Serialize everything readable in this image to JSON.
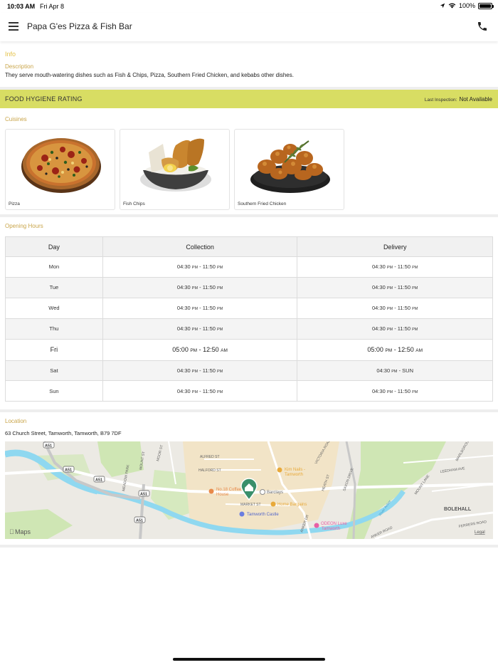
{
  "status_bar": {
    "time": "10:03 AM",
    "date": "Fri Apr 8",
    "battery": "100%"
  },
  "header": {
    "title": "Papa G'es Pizza & Fish Bar",
    "menu_icon": "hamburger-menu-icon",
    "phone_icon": "phone-icon"
  },
  "info": {
    "title": "Info",
    "description_label": "Description",
    "description": "They serve mouth-watering dishes such as Fish & Chips, Pizza, Southern Fried Chicken,  and kebabs other dishes."
  },
  "hygiene": {
    "title": "FOOD HYGIENE RATING",
    "last_inspection_label": "Last Inspection:",
    "last_inspection_value": "Not Available",
    "color": "#d8dd63"
  },
  "cuisines": {
    "label": "Cuisines",
    "items": [
      {
        "name": "Pizza"
      },
      {
        "name": "Fish  Chips"
      },
      {
        "name": "Southern Fried Chicken"
      }
    ]
  },
  "opening_hours": {
    "label": "Opening Hours",
    "headers": [
      "Day",
      "Collection",
      "Delivery"
    ],
    "rows": [
      {
        "day": "Mon",
        "c_start": "04:30",
        "c_start_ampm": "PM",
        "c_end": " - 11:50",
        "c_end_ampm": "PM",
        "d_start": "04:30",
        "d_start_ampm": "PM",
        "d_end": " - 11:50",
        "d_end_ampm": "PM"
      },
      {
        "day": "Tue",
        "c_start": "04:30",
        "c_start_ampm": "PM",
        "c_end": " - 11:50",
        "c_end_ampm": "PM",
        "d_start": "04:30",
        "d_start_ampm": "PM",
        "d_end": " - 11:50",
        "d_end_ampm": "PM"
      },
      {
        "day": "Wed",
        "c_start": "04:30",
        "c_start_ampm": "PM",
        "c_end": " - 11:50",
        "c_end_ampm": "PM",
        "d_start": "04:30",
        "d_start_ampm": "PM",
        "d_end": " - 11:50",
        "d_end_ampm": "PM"
      },
      {
        "day": "Thu",
        "c_start": "04:30",
        "c_start_ampm": "PM",
        "c_end": " - 11:50",
        "c_end_ampm": "PM",
        "d_start": "04:30",
        "d_start_ampm": "PM",
        "d_end": " - 11:50",
        "d_end_ampm": "PM"
      },
      {
        "day": "Fri",
        "c_start": "05:00",
        "c_start_ampm": "PM",
        "c_end": " - 12:50",
        "c_end_ampm": "AM",
        "d_start": "05:00",
        "d_start_ampm": "PM",
        "d_end": " - 12:50",
        "d_end_ampm": "AM"
      },
      {
        "day": "Sat",
        "c_start": "04:30",
        "c_start_ampm": "PM",
        "c_end": " - 11:50",
        "c_end_ampm": "PM",
        "d_start": "04:30",
        "d_start_ampm": "PM",
        "d_end": " - SUN",
        "d_end_ampm": ""
      },
      {
        "day": "Sun",
        "c_start": "04:30",
        "c_start_ampm": "PM",
        "c_end": " - 11:50",
        "c_end_ampm": "PM",
        "d_start": "04:30",
        "d_start_ampm": "PM",
        "d_end": " - 11:50",
        "d_end_ampm": "PM"
      }
    ]
  },
  "location": {
    "label": "Location",
    "address": "63 Church Street, Tamworth, Tamworth, B79 7DF",
    "map": {
      "brand": "Maps",
      "legal": "Legal",
      "road_badge": "A51",
      "street_labels": [
        "ALFRED ST",
        "HALFORD ST",
        "MARKET ST",
        "VICTORIA ROAD",
        "SAXON DRIVE",
        "HEATH ST",
        "ANKER DR",
        "MOOR ST",
        "MEADOW PARK",
        "MOUNT ST",
        "LEEDHAM AVE",
        "MOUNT LANE",
        "BOLEHALL",
        "FERRERS ROAD",
        "MARLBOROUGH",
        "ANKER ROAD",
        "River Anker"
      ],
      "pois": [
        {
          "name": "No.18 Coffee House",
          "color": "#e8894a"
        },
        {
          "name": "Barclays",
          "color": "#8a8a8a"
        },
        {
          "name": "Kim Nails - Tamworth",
          "color": "#e8a93a"
        },
        {
          "name": "Home Bargains",
          "color": "#e8a93a"
        },
        {
          "name": "Tamworth Castle",
          "color": "#6b7de0"
        },
        {
          "name": "ODEON Luxe Tamworth",
          "color": "#e85fa5"
        }
      ],
      "pin_color": "#3a8f6b"
    }
  }
}
